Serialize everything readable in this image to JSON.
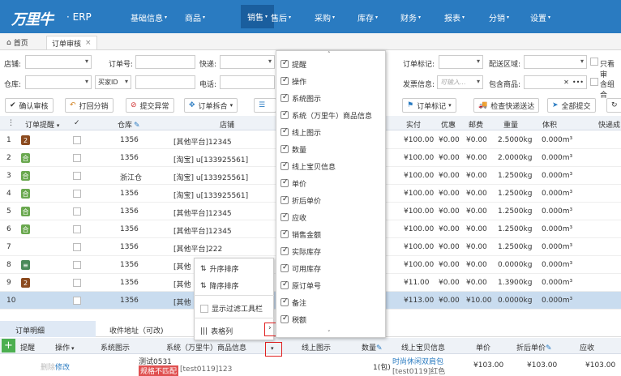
{
  "app": {
    "logo": "万里牛",
    "suffix": "· ERP"
  },
  "nav": [
    {
      "label": "基础信息"
    },
    {
      "label": "商品"
    },
    {
      "label": "销售"
    },
    {
      "label": "售后"
    },
    {
      "label": "采购"
    },
    {
      "label": "库存"
    },
    {
      "label": "财务"
    },
    {
      "label": "报表"
    },
    {
      "label": "分销"
    },
    {
      "label": "设置"
    }
  ],
  "tabs": {
    "home": "首页",
    "current": "订单审核",
    "close": "×"
  },
  "filters": {
    "shop": "店铺:",
    "order_no": "订单号:",
    "express": "快递:",
    "warehouse": "仓库:",
    "buyer_id": "买家ID",
    "phone": "电话:",
    "order_mark": "订单标记:",
    "delivery_area": "配送区域:",
    "only_view": "只看审",
    "invoice": "发票信息:",
    "invoice_ph": "可输入...",
    "include_goods": "包含商品:",
    "include_gift": "含组合"
  },
  "toolbar": {
    "confirm": "确认审核",
    "print": "打回分销",
    "exception": "提交异常",
    "split": "订单拆合",
    "mark": "订单标记",
    "check_express": "检查快递送达",
    "submit_all": "全部提交"
  },
  "grid_headers": {
    "remind": "订单提醒",
    "warehouse": "仓库",
    "shop": "店铺",
    "paid": "实付",
    "discount": "优惠",
    "postage": "邮费",
    "weight": "重量",
    "volume": "体积",
    "express_to": "快递成"
  },
  "rows": [
    {
      "n": "1",
      "badge": "2",
      "bc": "#8b4a1e",
      "wh": "1356",
      "shop": "[其他平台]12345",
      "paid": "¥100.00",
      "disc": "¥0.00",
      "post": "¥0.00",
      "wt": "2.5000kg",
      "vol": "0.000m³"
    },
    {
      "n": "2",
      "badge": "合",
      "bc": "#6aa84f",
      "wh": "1356",
      "shop": "[淘宝] u[133925561]",
      "paid": "¥100.00",
      "disc": "¥0.00",
      "post": "¥0.00",
      "wt": "2.0000kg",
      "vol": "0.000m³"
    },
    {
      "n": "3",
      "badge": "合",
      "bc": "#6aa84f",
      "wh": "浙江仓",
      "shop": "[淘宝] u[133925561]",
      "paid": "¥100.00",
      "disc": "¥0.00",
      "post": "¥0.00",
      "wt": "1.2500kg",
      "vol": "0.000m³"
    },
    {
      "n": "4",
      "badge": "合",
      "bc": "#6aa84f",
      "wh": "1356",
      "shop": "[淘宝] u[133925561]",
      "paid": "¥100.00",
      "disc": "¥0.00",
      "post": "¥0.00",
      "wt": "1.2500kg",
      "vol": "0.000m³"
    },
    {
      "n": "5",
      "badge": "合",
      "bc": "#6aa84f",
      "wh": "1356",
      "shop": "[其他平台]12345",
      "paid": "¥100.00",
      "disc": "¥0.00",
      "post": "¥0.00",
      "wt": "1.2500kg",
      "vol": "0.000m³"
    },
    {
      "n": "6",
      "badge": "合",
      "bc": "#6aa84f",
      "wh": "1356",
      "shop": "[其他平台]12345",
      "paid": "¥100.00",
      "disc": "¥0.00",
      "post": "¥0.00",
      "wt": "1.2500kg",
      "vol": "0.000m³"
    },
    {
      "n": "7",
      "badge": "",
      "bc": "",
      "wh": "1356",
      "shop": "[其他平台]222",
      "paid": "¥100.00",
      "disc": "¥0.00",
      "post": "¥0.00",
      "wt": "1.2500kg",
      "vol": "0.000m³"
    },
    {
      "n": "8",
      "badge": "≡",
      "bc": "#4a8a5a",
      "wh": "1356",
      "shop": "[其他",
      "paid": "¥100.00",
      "disc": "¥0.00",
      "post": "¥0.00",
      "wt": "0.0000kg",
      "vol": "0.000m³"
    },
    {
      "n": "9",
      "badge": "2",
      "bc": "#8b4a1e",
      "wh": "1356",
      "shop": "[其他",
      "paid": "¥11.00",
      "disc": "¥0.00",
      "post": "¥0.00",
      "wt": "1.3900kg",
      "vol": "0.000m³"
    },
    {
      "n": "10",
      "badge": "",
      "bc": "",
      "wh": "1356",
      "shop": "[其他",
      "paid": "¥113.00",
      "disc": "¥0.00",
      "post": "¥10.00",
      "wt": "0.0000kg",
      "vol": "0.000m³"
    }
  ],
  "context_menu": {
    "asc": "升序排序",
    "desc": "降序排序",
    "filter_bar": "显示过滤工具栏",
    "columns": "表格列"
  },
  "column_popup": [
    "提醒",
    "操作",
    "系统图示",
    "系统（万里牛）商品信息",
    "线上图示",
    "数量",
    "线上宝贝信息",
    "单价",
    "折后单价",
    "应收",
    "销售金额",
    "实际库存",
    "可用库存",
    "原订单号",
    "备注",
    "税额"
  ],
  "bottom_tabs": {
    "detail": "订单明细",
    "address": "收件地址（可改)"
  },
  "detail_headers": {
    "remind": "提醒",
    "op": "操作",
    "sys_img": "系统图示",
    "sys_info": "系统（万里牛）商品信息",
    "online_img": "线上图示",
    "qty": "数量",
    "online_info": "线上宝贝信息",
    "price": "单价",
    "disc_price": "折后单价",
    "receivable": "应收"
  },
  "detail_row": {
    "del": "删除",
    "edit": "修改",
    "name": "测试0531",
    "spec": "规格不匹配",
    "code": "[test0119]123",
    "qty": "1(包)",
    "online_name": "时尚休闲双肩包",
    "online_code": "[test0119]红色",
    "price": "¥103.00",
    "disc_price": "¥103.00",
    "recv": "¥103.00"
  }
}
